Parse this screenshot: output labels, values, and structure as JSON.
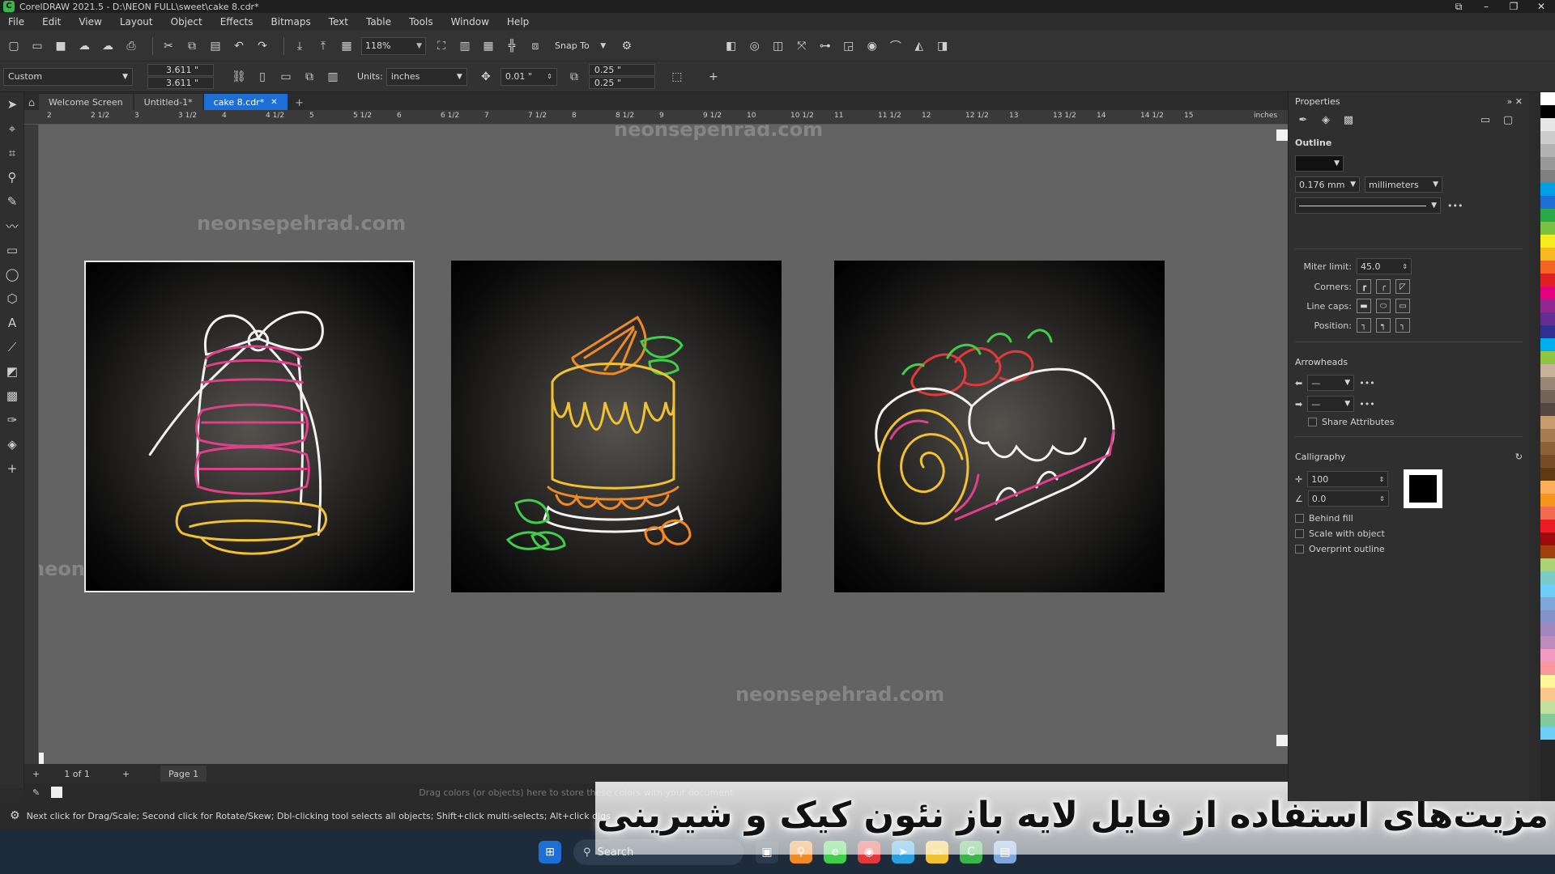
{
  "window": {
    "title": "CorelDRAW 2021.5 - D:\\NEON FULL\\sweet\\cake 8.cdr*",
    "controls": [
      "⧉",
      "–",
      "❐",
      "✕"
    ]
  },
  "menu": [
    "File",
    "Edit",
    "View",
    "Layout",
    "Object",
    "Effects",
    "Bitmaps",
    "Text",
    "Table",
    "Tools",
    "Window",
    "Help"
  ],
  "toolbar": {
    "zoom": "118%",
    "snap_to": "Snap To"
  },
  "property_bar": {
    "preset": "Custom",
    "width": "3.611 \"",
    "height": "3.611 \"",
    "units_label": "Units:",
    "units": "inches",
    "nudge": "0.01 \"",
    "dup_x": "0.25 \"",
    "dup_y": "0.25 \""
  },
  "tabs": [
    {
      "label": "Welcome Screen",
      "active": false
    },
    {
      "label": "Untitled-1*",
      "active": false
    },
    {
      "label": "cake 8.cdr*",
      "active": true
    }
  ],
  "ruler": {
    "labels": [
      "2",
      "2 1/2",
      "3",
      "3 1/2",
      "4",
      "4 1/2",
      "5",
      "5 1/2",
      "6",
      "6 1/2",
      "7",
      "7 1/2",
      "8",
      "8 1/2",
      "9",
      "9 1/2",
      "10",
      "10 1/2",
      "11",
      "11 1/2",
      "12",
      "12 1/2",
      "13",
      "13 1/2",
      "14",
      "14 1/2",
      "15"
    ],
    "unit": "inches"
  },
  "watermark": "neonsepehrad.com",
  "pagebar": {
    "count": "1 of 1",
    "page": "Page 1"
  },
  "palette_hint": "Drag colors (or objects) here to store these colors with your document",
  "status": "Next click for Drag/Scale; Second click for Rotate/Skew; Dbl-clicking tool selects all objects; Shift+click multi-selects; Alt+click digs",
  "taskbar": {
    "search": "Search"
  },
  "caption": "مزیت‌های استفاده از فایل لایه باز نئون کیک و شیرینی",
  "properties": {
    "title": "Properties",
    "outline_label": "Outline",
    "width_value": "0.176 mm",
    "width_units": "millimeters",
    "miter_label": "Miter limit:",
    "miter_value": "45.0",
    "corners_label": "Corners:",
    "linecaps_label": "Line caps:",
    "position_label": "Position:",
    "arrowheads_label": "Arrowheads",
    "share_attributes": "Share Attributes",
    "calligraphy_label": "Calligraphy",
    "stretch_value": "100",
    "angle_value": "0.0",
    "behind_fill": "Behind fill",
    "scale_with_object": "Scale with object",
    "overprint_outline": "Overprint outline"
  },
  "colors": {
    "accent": "#1d6fd6",
    "neon_white": "#f2f2f2",
    "neon_pink": "#e0408a",
    "neon_yellow": "#f2c230",
    "neon_orange": "#f08a24",
    "neon_green": "#3fcf4a",
    "neon_red": "#e23a3a"
  },
  "palette_swatches": [
    "#ffffff",
    "#000000",
    "#e6e6e6",
    "#cccccc",
    "#b3b3b3",
    "#999999",
    "#808080",
    "#00a0e9",
    "#1d6fd6",
    "#2aa84a",
    "#7cc242",
    "#f7ec1b",
    "#f8b81f",
    "#f26522",
    "#e02020",
    "#e6007e",
    "#92278f",
    "#662d91",
    "#2e3192",
    "#00aeef",
    "#8dc63f",
    "#c7b299",
    "#998675",
    "#736357",
    "#534741",
    "#c69c6d",
    "#a67c52",
    "#8c6239",
    "#754c24",
    "#603913",
    "#fbaf5d",
    "#f7941d",
    "#f26c4f",
    "#ed1c24",
    "#9e0b0f",
    "#a0410d",
    "#acd373",
    "#7accc8",
    "#6dcff6",
    "#7da7d9",
    "#8393ca",
    "#a187be",
    "#bd8cbf",
    "#f49ac1",
    "#f6989d",
    "#fff799",
    "#fdc68a",
    "#c4df9b",
    "#82ca9c",
    "#6ecff6"
  ]
}
